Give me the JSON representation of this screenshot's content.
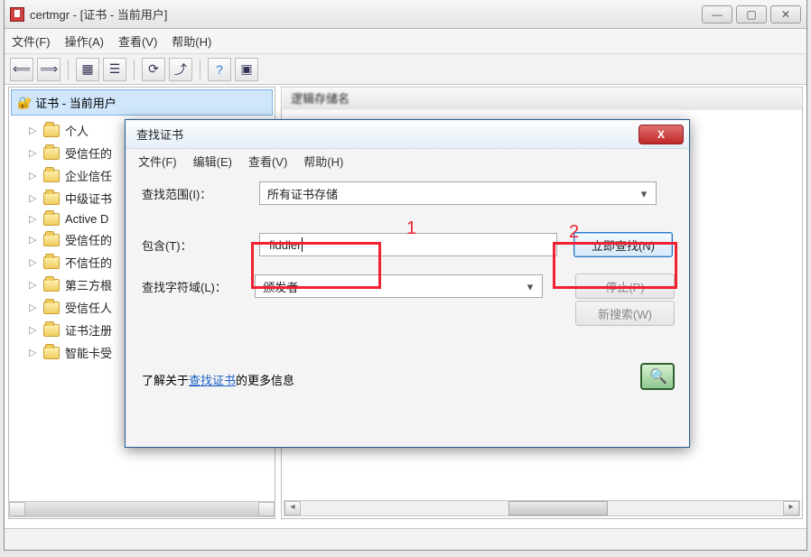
{
  "main": {
    "title": "certmgr - [证书 - 当前用户]",
    "menu": {
      "file": "文件(F)",
      "action": "操作(A)",
      "view": "查看(V)",
      "help": "帮助(H)"
    },
    "tree_root": "证书 - 当前用户",
    "tree": [
      "个人",
      "受信任的",
      "企业信任",
      "中级证书",
      "Active D",
      "受信任的",
      "不信任的",
      "第三方根",
      "受信任人",
      "证书注册",
      "智能卡受"
    ],
    "right_header": "逻辑存储名"
  },
  "dialog": {
    "title": "查找证书",
    "menu": {
      "file": "文件(F)",
      "edit": "编辑(E)",
      "view": "查看(V)",
      "help": "帮助(H)"
    },
    "scope_label": "查找范围(I)：",
    "scope_value": "所有证书存储",
    "contains_label": "包含(T)：",
    "contains_value": "fiddler",
    "field_label": "查找字符域(L)：",
    "field_value": "颁发者",
    "buttons": {
      "find_now": "立即查找(N)",
      "stop": "停止(P)",
      "new_search": "新搜索(W)"
    },
    "help_prefix": "了解关于",
    "help_link": "查找证书",
    "help_suffix": "的更多信息"
  },
  "annotations": {
    "one": "1",
    "two": "2"
  }
}
